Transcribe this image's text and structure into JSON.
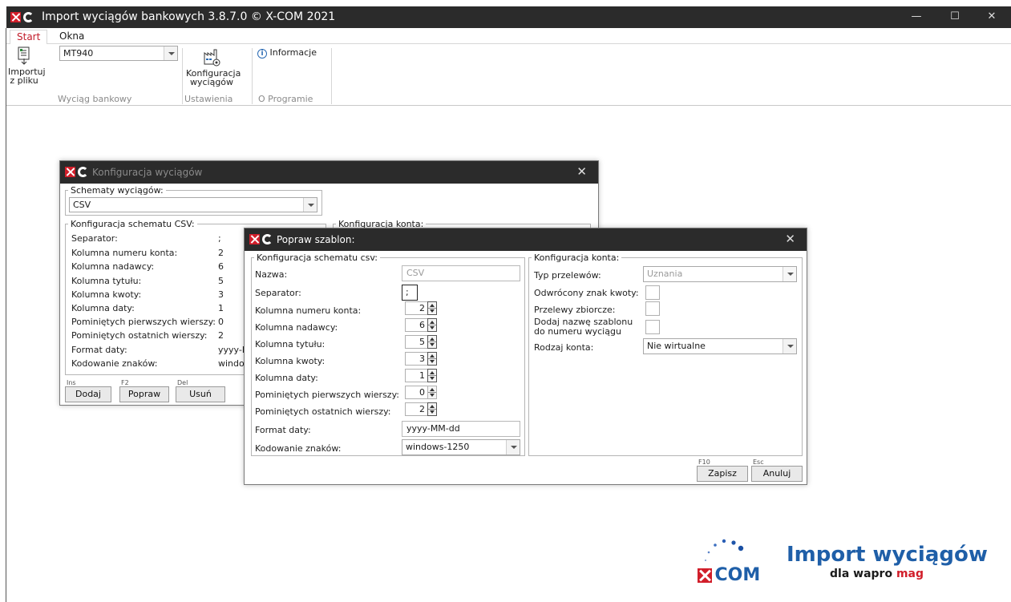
{
  "window": {
    "title": "Import wyciągów bankowych 3.8.7.0 © X-COM 2021",
    "minimize": "—",
    "maximize": "☐",
    "close": "✕"
  },
  "tabs": [
    {
      "label": "Start",
      "active": true
    },
    {
      "label": "Okna",
      "active": false
    }
  ],
  "ribbon": {
    "import_label_1": "Importuj",
    "import_label_2": "z pliku",
    "format_value": "MT940",
    "config_label_1": "Konfiguracja",
    "config_label_2": "wyciągów",
    "info_label": "Informacje",
    "groups": [
      "Wyciąg bankowy",
      "Ustawienia",
      "O Programie"
    ]
  },
  "dialog_config": {
    "title": "Konfiguracja wyciągów",
    "close": "✕",
    "schemas_legend": "Schematy wyciągów:",
    "schema_value": "CSV",
    "csv_legend": "Konfiguracja schematu CSV:",
    "account_legend": "Konfiguracja konta:",
    "rows": [
      {
        "label": "Separator:",
        "value": ";"
      },
      {
        "label": "Kolumna numeru konta:",
        "value": "2"
      },
      {
        "label": "Kolumna nadawcy:",
        "value": "6"
      },
      {
        "label": "Kolumna tytułu:",
        "value": "5"
      },
      {
        "label": "Kolumna kwoty:",
        "value": "3"
      },
      {
        "label": "Kolumna daty:",
        "value": "1"
      },
      {
        "label": "Pominiętych pierwszych wierszy:",
        "value": "0"
      },
      {
        "label": "Pominiętych ostatnich wierszy:",
        "value": "2"
      },
      {
        "label": "Format daty:",
        "value": "yyyy-M"
      },
      {
        "label": "Kodowanie znaków:",
        "value": "windo"
      }
    ],
    "buttons": [
      {
        "hint": "Ins",
        "label": "Dodaj"
      },
      {
        "hint": "F2",
        "label": "Popraw"
      },
      {
        "hint": "Del",
        "label": "Usuń"
      }
    ]
  },
  "dialog_edit": {
    "title": "Popraw szablon:",
    "close": "✕",
    "csv_legend": "Konfiguracja schematu csv:",
    "name_label": "Nazwa:",
    "name_value": "CSV",
    "separator_label": "Separator:",
    "separator_value": ";",
    "spin_rows": [
      {
        "label": "Kolumna numeru konta:",
        "value": "2"
      },
      {
        "label": "Kolumna nadawcy:",
        "value": "6"
      },
      {
        "label": "Kolumna tytułu:",
        "value": "5"
      },
      {
        "label": "Kolumna kwoty:",
        "value": "3"
      },
      {
        "label": "Kolumna daty:",
        "value": "1"
      },
      {
        "label": "Pominiętych pierwszych wierszy:",
        "value": "0"
      },
      {
        "label": "Pominiętych ostatnich wierszy:",
        "value": "2"
      }
    ],
    "date_format_label": "Format daty:",
    "date_format_value": "yyyy-MM-dd",
    "encoding_label": "Kodowanie znaków:",
    "encoding_value": "windows-1250",
    "account_legend": "Konfiguracja konta:",
    "transfer_type_label": "Typ przelewów:",
    "transfer_type_value": "Uznania",
    "reversed_sign_label": "Odwrócony znak kwoty:",
    "bulk_label": "Przelewy zbiorcze:",
    "add_name_label_1": "Dodaj nazwę szablonu",
    "add_name_label_2": "do numeru wyciągu",
    "account_kind_label": "Rodzaj konta:",
    "account_kind_value": "Nie wirtualne",
    "save_hint": "F10",
    "save_label": "Zapisz",
    "cancel_hint": "Esc",
    "cancel_label": "Anuluj"
  },
  "brand": {
    "product": "Import wyciągów",
    "sub_prefix": "dla wapro ",
    "sub_suffix": "mag",
    "company": "COM",
    "color_red": "#d11e2a",
    "color_blue": "#1f5fa8"
  }
}
